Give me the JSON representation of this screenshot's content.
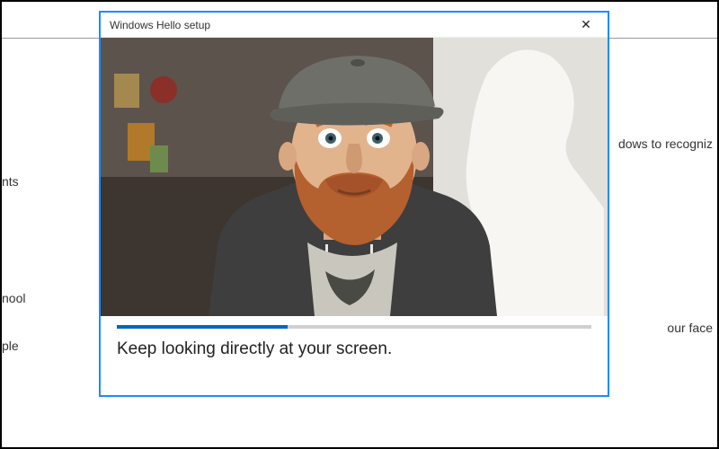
{
  "background": {
    "left_items": [
      "nts",
      "nool",
      "ple"
    ],
    "right_items": [
      "dows to recogniz",
      "our face"
    ]
  },
  "dialog": {
    "title": "Windows Hello setup",
    "close_glyph": "✕",
    "instruction": "Keep looking directly at your screen.",
    "progress_percent": 36
  }
}
